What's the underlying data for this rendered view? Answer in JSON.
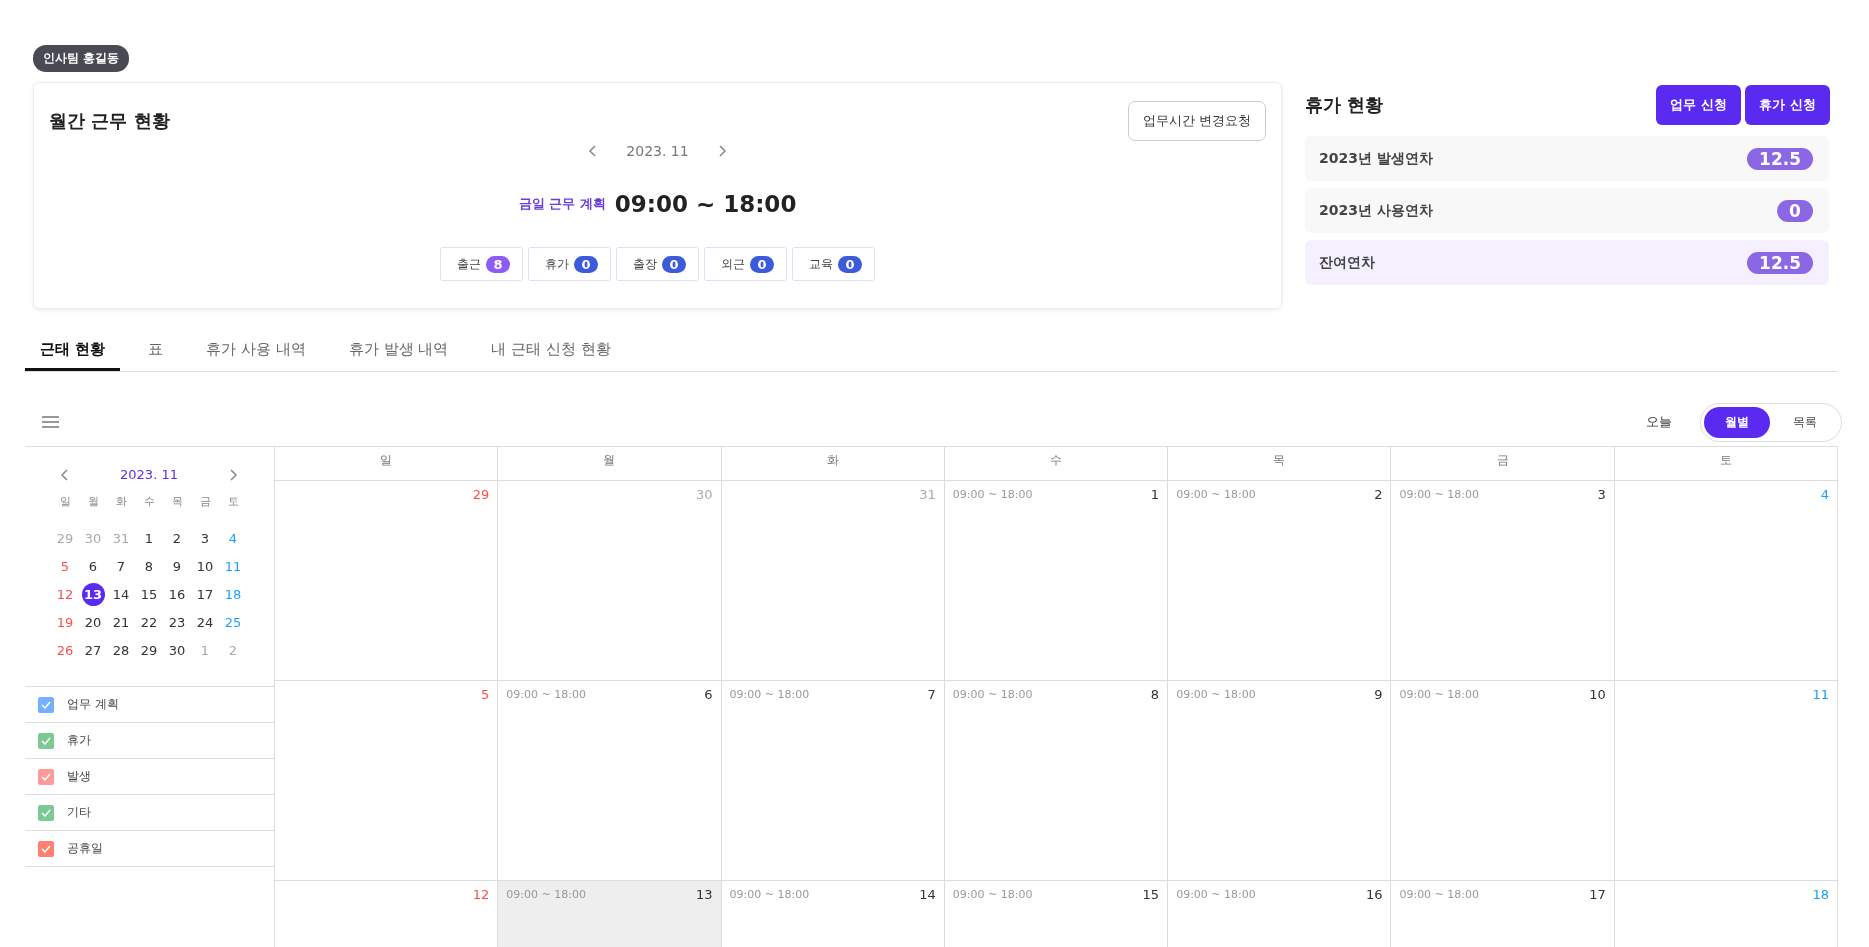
{
  "user_badge": "인사팀 홍길동",
  "monthly_card": {
    "title": "월간 근무 현황",
    "change_button": "업무시간 변경요청",
    "month": "2023. 11",
    "plan_label": "금일 근무 계획",
    "plan_time": "09:00 ~ 18:00",
    "stats": [
      {
        "label": "출근",
        "count": "8",
        "color": "#8b5cf6"
      },
      {
        "label": "휴가",
        "count": "0",
        "color": "#3b5bdb"
      },
      {
        "label": "출장",
        "count": "0",
        "color": "#3b5bdb"
      },
      {
        "label": "외근",
        "count": "0",
        "color": "#3b5bdb"
      },
      {
        "label": "교육",
        "count": "0",
        "color": "#3b5bdb"
      }
    ]
  },
  "leave_panel": {
    "title": "휴가 현황",
    "buttons": [
      "업무 신청",
      "휴가 신청"
    ],
    "rows": [
      {
        "label": "2023년 발생연차",
        "value": "12.5",
        "kind": "normal"
      },
      {
        "label": "2023년 사용연차",
        "value": "0",
        "kind": "normal"
      },
      {
        "label": "잔여연차",
        "value": "12.5",
        "kind": "total"
      }
    ]
  },
  "tabs": [
    {
      "label": "근태 현황",
      "selected": true
    },
    {
      "label": "표",
      "selected": false
    },
    {
      "label": "휴가 사용 내역",
      "selected": false
    },
    {
      "label": "휴가 발생 내역",
      "selected": false
    },
    {
      "label": "내 근태 신청 현황",
      "selected": false
    }
  ],
  "toolbar": {
    "today": "오늘",
    "views": [
      {
        "label": "월별",
        "selected": true
      },
      {
        "label": "목록",
        "selected": false
      }
    ]
  },
  "mini_calendar": {
    "month": "2023. 11",
    "weekdays": [
      "일",
      "월",
      "화",
      "수",
      "목",
      "금",
      "토"
    ],
    "weeks": [
      [
        {
          "day": "29",
          "color": "#aaaaaa",
          "selected": false
        },
        {
          "day": "30",
          "color": "#aaaaaa",
          "selected": false
        },
        {
          "day": "31",
          "color": "#aaaaaa",
          "selected": false
        },
        {
          "day": "1",
          "color": "#333333",
          "selected": false
        },
        {
          "day": "2",
          "color": "#333333",
          "selected": false
        },
        {
          "day": "3",
          "color": "#333333",
          "selected": false
        },
        {
          "day": "4",
          "color": "#1a9fff",
          "selected": false
        }
      ],
      [
        {
          "day": "5",
          "color": "#ff4d4f",
          "selected": false
        },
        {
          "day": "6",
          "color": "#333333",
          "selected": false
        },
        {
          "day": "7",
          "color": "#333333",
          "selected": false
        },
        {
          "day": "8",
          "color": "#333333",
          "selected": false
        },
        {
          "day": "9",
          "color": "#333333",
          "selected": false
        },
        {
          "day": "10",
          "color": "#333333",
          "selected": false
        },
        {
          "day": "11",
          "color": "#1a9fff",
          "selected": false
        }
      ],
      [
        {
          "day": "12",
          "color": "#ff4d4f",
          "selected": false
        },
        {
          "day": "13",
          "selected": true
        },
        {
          "day": "14",
          "color": "#333333",
          "selected": false
        },
        {
          "day": "15",
          "color": "#333333",
          "selected": false
        },
        {
          "day": "16",
          "color": "#333333",
          "selected": false
        },
        {
          "day": "17",
          "color": "#333333",
          "selected": false
        },
        {
          "day": "18",
          "color": "#1a9fff",
          "selected": false
        }
      ],
      [
        {
          "day": "19",
          "color": "#ff4d4f",
          "selected": false
        },
        {
          "day": "20",
          "color": "#333333",
          "selected": false
        },
        {
          "day": "21",
          "color": "#333333",
          "selected": false
        },
        {
          "day": "22",
          "color": "#333333",
          "selected": false
        },
        {
          "day": "23",
          "color": "#333333",
          "selected": false
        },
        {
          "day": "24",
          "color": "#333333",
          "selected": false
        },
        {
          "day": "25",
          "color": "#1a9fff",
          "selected": false
        }
      ],
      [
        {
          "day": "26",
          "color": "#ff4d4f",
          "selected": false
        },
        {
          "day": "27",
          "color": "#333333",
          "selected": false
        },
        {
          "day": "28",
          "color": "#333333",
          "selected": false
        },
        {
          "day": "29",
          "color": "#333333",
          "selected": false
        },
        {
          "day": "30",
          "color": "#333333",
          "selected": false
        },
        {
          "day": "1",
          "color": "#aaaaaa",
          "selected": false
        },
        {
          "day": "2",
          "color": "#aaaaaa",
          "selected": false
        }
      ]
    ]
  },
  "legend": [
    {
      "label": "업무 계획",
      "checked": true,
      "color": "#74b0ff"
    },
    {
      "label": "휴가",
      "checked": true,
      "color": "#7cc994"
    },
    {
      "label": "발생",
      "checked": true,
      "color": "#ff9a9a"
    },
    {
      "label": "기타",
      "checked": true,
      "color": "#7cc994"
    },
    {
      "label": "공휴일",
      "checked": true,
      "color": "#ff7f73"
    }
  ],
  "calendar": {
    "weekdays": [
      "일",
      "월",
      "화",
      "수",
      "목",
      "금",
      "토"
    ],
    "weeks": [
      [
        {
          "day": "29",
          "color": "#ff4d4f",
          "selected": false
        },
        {
          "day": "30",
          "color": "#aaaaaa",
          "selected": false
        },
        {
          "day": "31",
          "color": "#aaaaaa",
          "selected": false
        },
        {
          "day": "1",
          "color": "#333333",
          "plan": "09:00 ~ 18:00",
          "selected": false
        },
        {
          "day": "2",
          "color": "#333333",
          "plan": "09:00 ~ 18:00",
          "selected": false
        },
        {
          "day": "3",
          "color": "#333333",
          "plan": "09:00 ~ 18:00",
          "selected": false
        },
        {
          "day": "4",
          "color": "#1a9fff",
          "selected": false
        }
      ],
      [
        {
          "day": "5",
          "color": "#ff4d4f",
          "selected": false
        },
        {
          "day": "6",
          "color": "#333333",
          "plan": "09:00 ~ 18:00",
          "selected": false
        },
        {
          "day": "7",
          "color": "#333333",
          "plan": "09:00 ~ 18:00",
          "selected": false
        },
        {
          "day": "8",
          "color": "#333333",
          "plan": "09:00 ~ 18:00",
          "selected": false
        },
        {
          "day": "9",
          "color": "#333333",
          "plan": "09:00 ~ 18:00",
          "selected": false
        },
        {
          "day": "10",
          "color": "#333333",
          "plan": "09:00 ~ 18:00",
          "selected": false
        },
        {
          "day": "11",
          "color": "#1a9fff",
          "selected": false
        }
      ],
      [
        {
          "day": "12",
          "color": "#ff4d4f",
          "selected": false
        },
        {
          "day": "13",
          "color": "#333333",
          "plan": "09:00 ~ 18:00",
          "selected": true
        },
        {
          "day": "14",
          "color": "#333333",
          "plan": "09:00 ~ 18:00",
          "selected": false
        },
        {
          "day": "15",
          "color": "#333333",
          "plan": "09:00 ~ 18:00",
          "selected": false
        },
        {
          "day": "16",
          "color": "#333333",
          "plan": "09:00 ~ 18:00",
          "selected": false
        },
        {
          "day": "17",
          "color": "#333333",
          "plan": "09:00 ~ 18:00",
          "selected": false
        },
        {
          "day": "18",
          "color": "#1a9fff",
          "selected": false
        }
      ]
    ]
  }
}
